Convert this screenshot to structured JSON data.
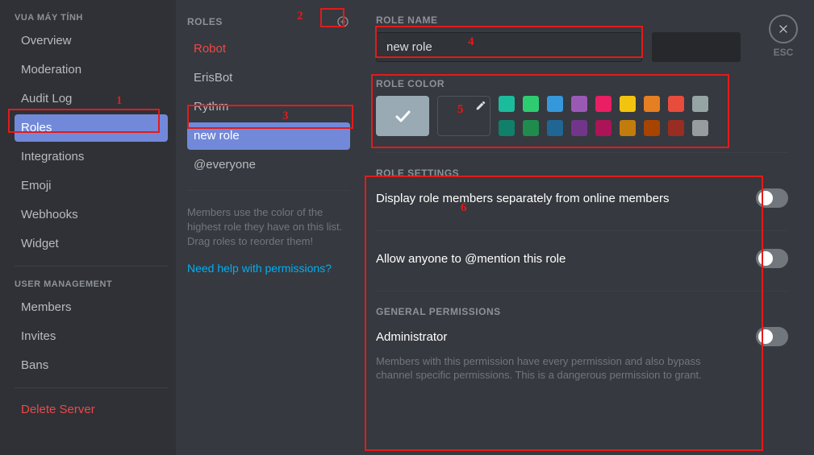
{
  "sidebar": {
    "section1_title": "VUA MÁY TÍNH",
    "section2_title": "USER MANAGEMENT",
    "items1": [
      "Overview",
      "Moderation",
      "Audit Log",
      "Roles",
      "Integrations",
      "Emoji",
      "Webhooks",
      "Widget"
    ],
    "items2": [
      "Members",
      "Invites",
      "Bans"
    ],
    "delete": "Delete Server",
    "selected_index": 3
  },
  "roles": {
    "header": "ROLES",
    "items": [
      "Robot",
      "ErisBot",
      "Rythm",
      "new role",
      "@everyone"
    ],
    "selected_index": 3,
    "note": "Members use the color of the highest role they have on this list. Drag roles to reorder them!",
    "help": "Need help with permissions?"
  },
  "editor": {
    "name_label": "ROLE NAME",
    "name_value": "new role",
    "color_label": "ROLE COLOR",
    "settings_label": "ROLE SETTINGS",
    "perm_section_label": "GENERAL PERMISSIONS",
    "settings": [
      {
        "title": "Display role members separately from online members",
        "desc": ""
      },
      {
        "title": "Allow anyone to @mention this role",
        "desc": ""
      }
    ],
    "perms": [
      {
        "title": "Administrator",
        "desc": "Members with this permission have every permission and also bypass channel specific permissions. This is a dangerous permission to grant."
      }
    ],
    "colors_row1": [
      "#1abc9c",
      "#2ecc71",
      "#3498db",
      "#9b59b6",
      "#e91e63",
      "#f1c40f",
      "#e67e22",
      "#e74c3c",
      "#95a5a6"
    ],
    "colors_row2": [
      "#11806a",
      "#1f8b4c",
      "#206694",
      "#71368a",
      "#ad1457",
      "#c27c0e",
      "#a84300",
      "#992d22",
      "#979c9f"
    ]
  },
  "close_label": "ESC",
  "annotations": {
    "n1": "1",
    "n2": "2",
    "n3": "3",
    "n4": "4",
    "n5": "5",
    "n6": "6"
  }
}
